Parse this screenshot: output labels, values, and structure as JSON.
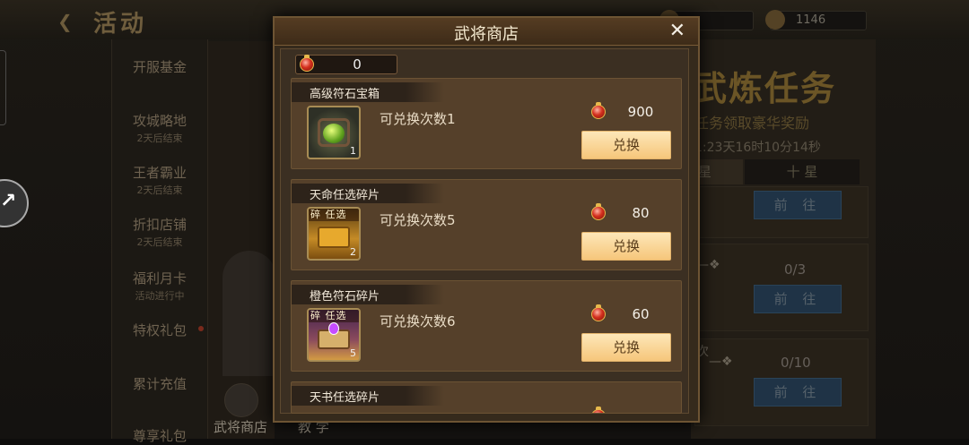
{
  "background": {
    "title": "活动",
    "resource_a": "",
    "resource_b": "1146",
    "menu": [
      {
        "title": "开服基金",
        "sub": ""
      },
      {
        "title": "攻城略地",
        "sub": "2天后结束"
      },
      {
        "title": "王者霸业",
        "sub": "2天后结束"
      },
      {
        "title": "折扣店铺",
        "sub": "2天后结束"
      },
      {
        "title": "福利月卡",
        "sub": "活动进行中"
      },
      {
        "title": "特权礼包",
        "sub": ""
      },
      {
        "title": "累计充值",
        "sub": ""
      },
      {
        "title": "尊享礼包",
        "sub": ""
      }
    ],
    "banner": "武炼任务",
    "banner_sub": "任务领取豪华奖励",
    "timer": "1:23天16时10分14秒",
    "tab_active": "星",
    "tab_other": "十 星",
    "counts": [
      "0/3",
      "0/10"
    ],
    "go_label": "前 往",
    "bottom_label_1": "武将商店",
    "bottom_label_2": "教 学",
    "row_prefix": "次"
  },
  "modal": {
    "title": "武将商店",
    "close_icon": "close-icon",
    "balance": "0",
    "exchange_label": "兑换",
    "items": [
      {
        "name": "高级符石宝箱",
        "limit": "可兑换次数1",
        "price": "900",
        "qty": "1",
        "icon": "green-gem-chest-icon"
      },
      {
        "name": "天命任选碎片",
        "limit": "可兑换次数5",
        "price": "80",
        "qty": "2",
        "icon": "gold-chest-fragment-icon",
        "frag": "碎  任选"
      },
      {
        "name": "橙色符石碎片",
        "limit": "可兑换次数6",
        "price": "60",
        "qty": "5",
        "icon": "purple-rune-fragment-icon",
        "frag": "碎  任选"
      },
      {
        "name": "天书任选碎片",
        "limit": "",
        "price": "",
        "qty": "",
        "icon": "book-fragment-icon"
      }
    ]
  }
}
